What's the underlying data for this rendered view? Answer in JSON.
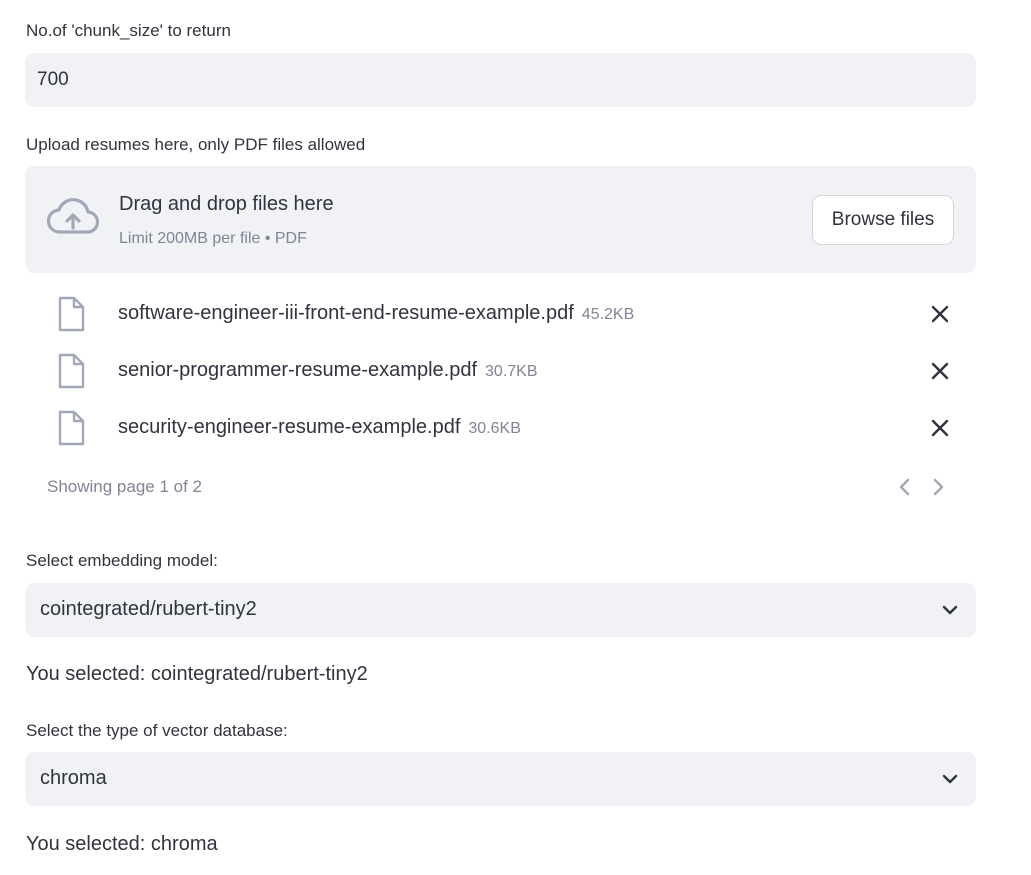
{
  "chunk": {
    "label": "No.of 'chunk_size' to return",
    "value": "700"
  },
  "upload": {
    "label": "Upload resumes here, only PDF files allowed",
    "drop_title": "Drag and drop files here",
    "drop_subtitle": "Limit 200MB per file • PDF",
    "browse_label": "Browse files",
    "files": [
      {
        "name": "software-engineer-iii-front-end-resume-example.pdf",
        "size": "45.2KB"
      },
      {
        "name": "senior-programmer-resume-example.pdf",
        "size": "30.7KB"
      },
      {
        "name": "security-engineer-resume-example.pdf",
        "size": "30.6KB"
      }
    ],
    "pager_text": "Showing page 1 of 2"
  },
  "embedding": {
    "label": "Select embedding model:",
    "value": "cointegrated/rubert-tiny2",
    "selected_text": "You selected: cointegrated/rubert-tiny2"
  },
  "vectordb": {
    "label": "Select the type of vector database:",
    "value": "chroma",
    "selected_text": "You selected: chroma"
  },
  "icons": {
    "upload": "cloud-upload-icon",
    "file": "file-icon",
    "remove": "close-icon",
    "prev": "chevron-left-icon",
    "next": "chevron-right-icon",
    "dropdown": "chevron-down-icon"
  },
  "colors": {
    "input_bg": "#f0f2f6",
    "text": "#31333f",
    "muted": "#808495",
    "icon": "#a3a8b8"
  }
}
